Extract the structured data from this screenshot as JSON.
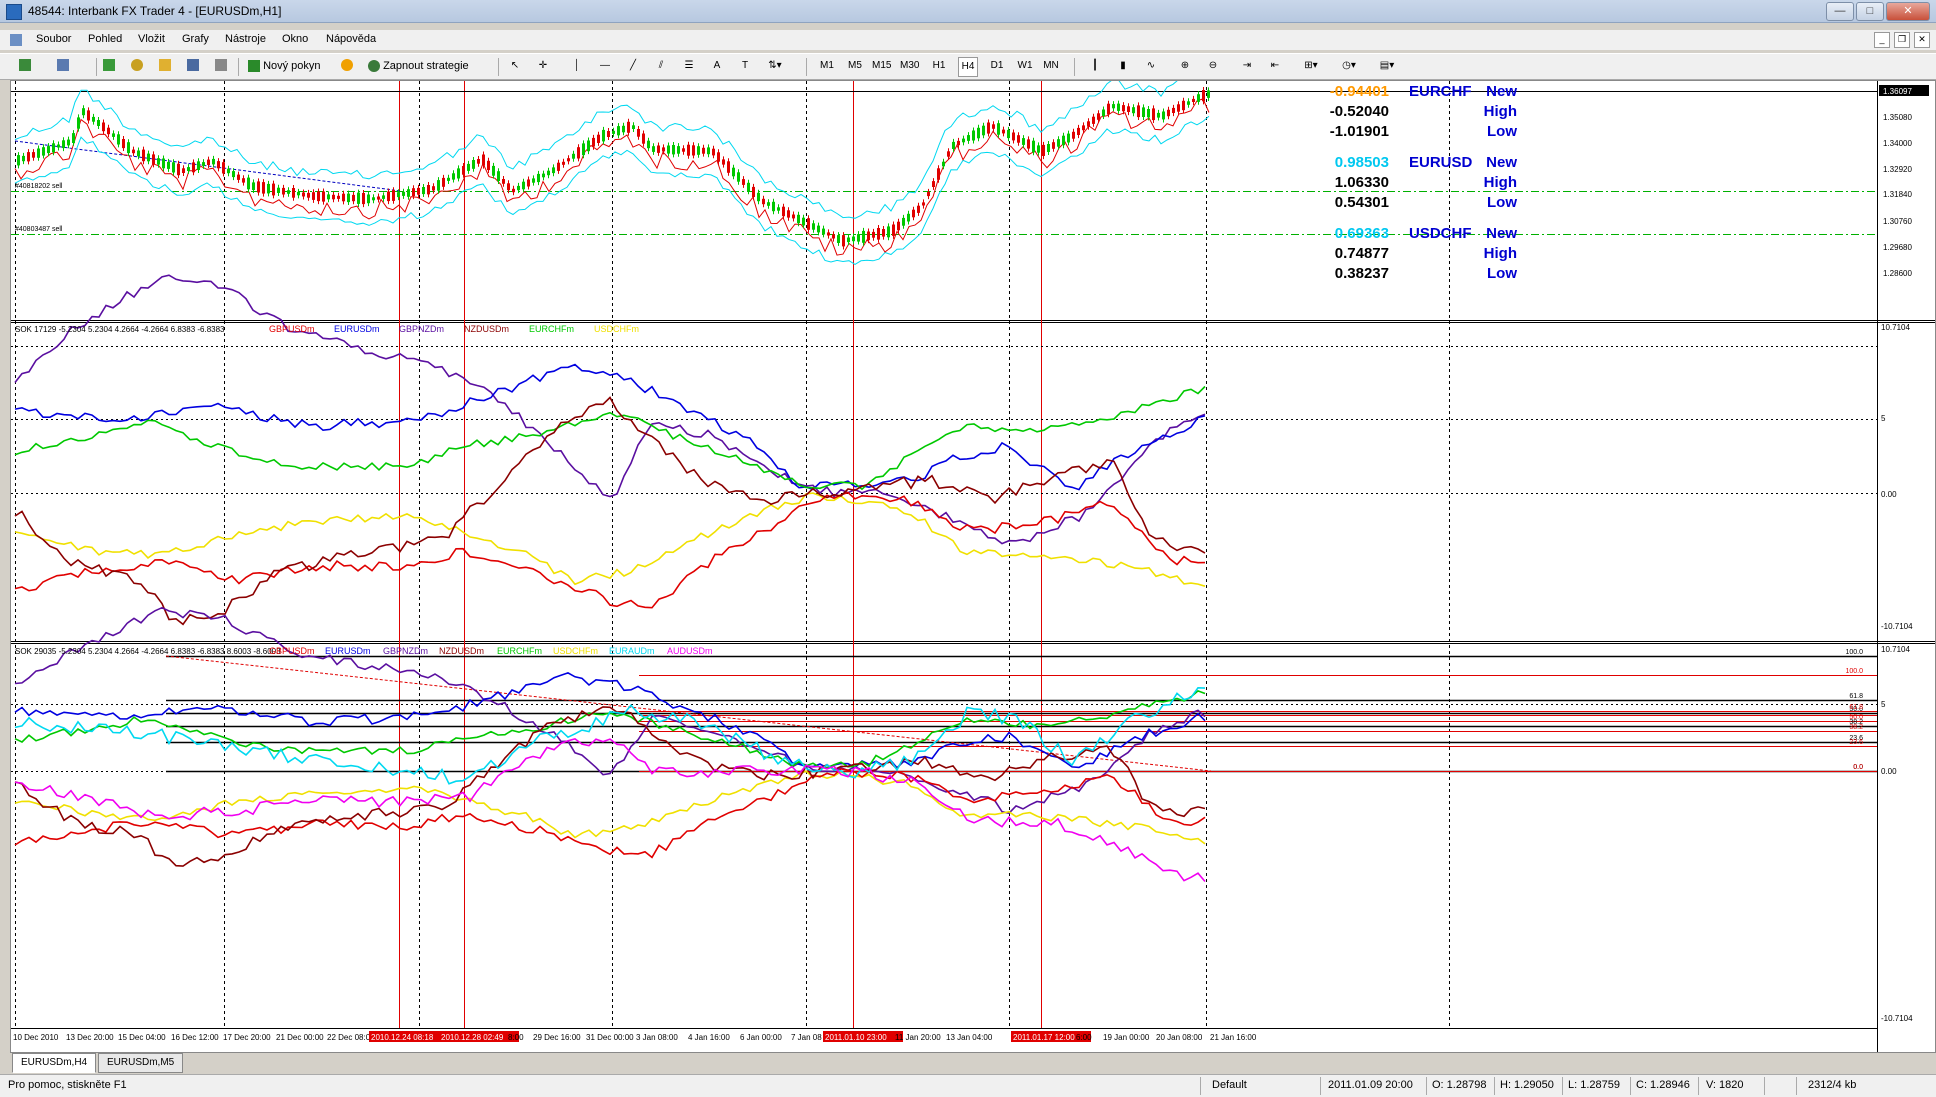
{
  "window": {
    "title": "48544: Interbank FX Trader 4 - [EURUSDm,H1]",
    "minimize": "—",
    "maximize": "□",
    "close": "✕"
  },
  "menu": [
    "Soubor",
    "Pohled",
    "Vložit",
    "Grafy",
    "Nástroje",
    "Okno",
    "Nápověda"
  ],
  "toolbar": {
    "new_order": "Nový pokyn",
    "strategy": "Zapnout strategie",
    "periods": [
      "M1",
      "M5",
      "M15",
      "M30",
      "H1",
      "H4",
      "D1",
      "W1",
      "MN"
    ]
  },
  "colors": {
    "GBPUSDm": "#e00000",
    "EURUSDm": "#0000e0",
    "GBPNZDm": "#5a0fa0",
    "NZDUSDm": "#8b0000",
    "EURCHFm": "#00c800",
    "USDCHFm": "#f0e000",
    "EURAUDm": "#00d8f0",
    "AUDUSDm": "#f000f0"
  },
  "main_chart": {
    "price_labels": [
      "1.36097",
      "1.35080",
      "1.34000",
      "1.32920",
      "1.31840",
      "1.30760",
      "1.29680",
      "1.28600"
    ],
    "current_price": "1.36097",
    "order_labels": [
      "#40818202 sell",
      "#40803487 sell"
    ],
    "panel": [
      {
        "symbol": "EURCHF",
        "value": "-0.94401",
        "value_color": "#ff9900",
        "high": "-0.52040",
        "low": "-1.01901",
        "labels": [
          "New",
          "High",
          "Low"
        ]
      },
      {
        "symbol": "EURUSD",
        "value": "0.98503",
        "value_color": "#00c8f0",
        "high": "1.06330",
        "low": "0.54301",
        "labels": [
          "New",
          "High",
          "Low"
        ]
      },
      {
        "symbol": "USDCHF",
        "value": "0.69363",
        "value_color": "#00c8f0",
        "high": "0.74877",
        "low": "0.38237",
        "labels": [
          "New",
          "High",
          "Low"
        ]
      }
    ]
  },
  "indicator1": {
    "header": "SOK 17129 -5.2304 5.2304 4.2664 -4.2664 6.8383 -6.8383",
    "legend": [
      "GBPUSDm",
      "EURUSDm",
      "GBPNZDm",
      "NZDUSDm",
      "EURCHFm",
      "USDCHFm"
    ],
    "scale": [
      "10.7104",
      "5",
      "0.00",
      "-10.7104"
    ]
  },
  "indicator2": {
    "header": "SOK 29035 -5.2304 5.2304 4.2664 -4.2664 6.8383 -6.8383 8.6003 -8.6003",
    "legend": [
      "GBPUSDm",
      "EURUSDm",
      "GBPNZDm",
      "NZDUSDm",
      "EURCHFm",
      "USDCHFm",
      "EURAUDm",
      "AUDUSDm"
    ],
    "scale": [
      "10.7104",
      "5",
      "0.00",
      "-10.7104"
    ],
    "fib_right": [
      "100.0",
      "61.8",
      "50.0",
      "38.2",
      "23.6",
      "0.0"
    ],
    "fib_red": [
      "100.0",
      "61.8",
      "50.0",
      "38.2",
      "23.6",
      "0.0"
    ]
  },
  "time_axis": [
    "10 Dec 2010",
    "13 Dec 20:00",
    "15 Dec 04:00",
    "16 Dec 12:00",
    "17 Dec 20:00",
    "21 Dec 00:00",
    "22 Dec 08:00",
    "2010.12.24 08:18",
    "2010.12.28 02:49",
    "8:00",
    "29 Dec 16:00",
    "31 Dec 00:00",
    "3 Jan 08:00",
    "4 Jan 16:00",
    "6 Jan 00:00",
    "7 Jan 08",
    "2011.01.10 23:00",
    "11 Jan 20:00",
    "13 Jan 04:00",
    "2011.01.17 12:00",
    "6:00",
    "19 Jan 00:00",
    "20 Jan 08:00",
    "21 Jan 16:00"
  ],
  "tabs": [
    "EURUSDm,H4",
    "EURUSDm,M5"
  ],
  "status": {
    "help": "Pro pomoc, stiskněte F1",
    "profile": "Default",
    "datetime": "2011.01.09 20:00",
    "open": "O: 1.28798",
    "high": "H: 1.29050",
    "low": "L: 1.28759",
    "close": "C: 1.28946",
    "volume": "V: 1820",
    "traffic": "2312/4 kb"
  }
}
